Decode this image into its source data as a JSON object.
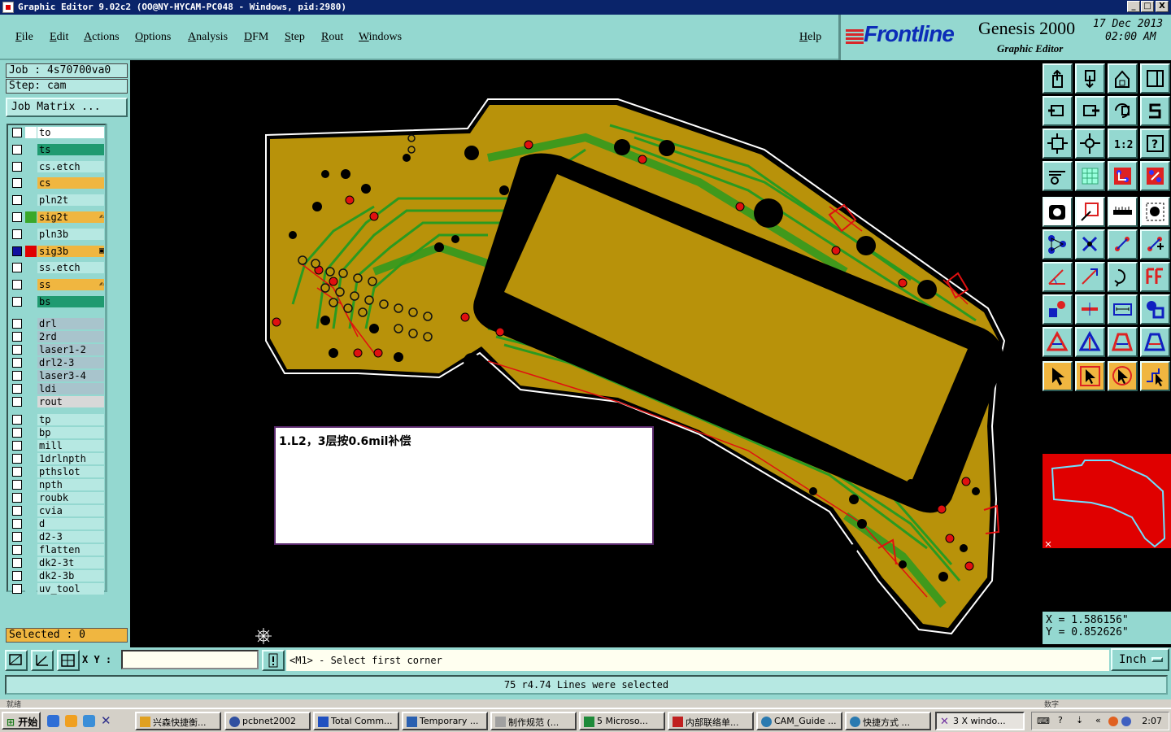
{
  "window": {
    "title": "Graphic Editor 9.02c2 (OO@NY-HYCAM-PC048 - Windows, pid:2980)",
    "controls": [
      "_",
      "□",
      "X"
    ]
  },
  "menu": [
    "File",
    "Edit",
    "Actions",
    "Options",
    "Analysis",
    "DFM",
    "Step",
    "Rout",
    "Windows"
  ],
  "help": "Help",
  "brand": {
    "logo": "Frontline",
    "product": "Genesis 2000",
    "subtitle": "Graphic Editor",
    "date": "17 Dec 2013",
    "time": "02:00 AM"
  },
  "job": {
    "job_line": "Job : 4s70700va0",
    "step_line": "Step: cam",
    "matrix_button": "Job Matrix ..."
  },
  "layers": [
    {
      "name": "to",
      "bg": "#ffffff",
      "swatch": "#ffffff"
    },
    {
      "name": "ts",
      "bg": "#1f9a70",
      "swatch": "#94d8d0"
    },
    {
      "name": "cs.etch",
      "bg": "#b6e8e2",
      "swatch": "#94d8d0"
    },
    {
      "name": "cs",
      "bg": "#f0b640",
      "swatch": "#94d8d0"
    },
    {
      "name": "pln2t",
      "bg": "#b6e8e2",
      "swatch": "#94d8d0"
    },
    {
      "name": "sig2t",
      "bg": "#f0b640",
      "swatch": "#3aa82a",
      "mark": "✍"
    },
    {
      "name": "pln3b",
      "bg": "#b6e8e2",
      "swatch": "#94d8d0"
    },
    {
      "name": "sig3b",
      "bg": "#f0b640",
      "swatch": "#e00000",
      "mark": "▣",
      "checkbox": "#1010a0"
    },
    {
      "name": "ss.etch",
      "bg": "#b6e8e2",
      "swatch": "#94d8d0"
    },
    {
      "name": "ss",
      "bg": "#f0b640",
      "swatch": "#94d8d0",
      "mark": "✍"
    },
    {
      "name": "bs",
      "bg": "#1f9a70",
      "swatch": "#94d8d0"
    },
    {
      "name": "drl",
      "bg": "#a8c4cc",
      "swatch": "#94d8d0"
    },
    {
      "name": "2rd",
      "bg": "#a8c4cc",
      "swatch": "#94d8d0"
    },
    {
      "name": "laser1-2",
      "bg": "#a8c4cc",
      "swatch": "#94d8d0"
    },
    {
      "name": "drl2-3",
      "bg": "#a8c4cc",
      "swatch": "#94d8d0"
    },
    {
      "name": "laser3-4",
      "bg": "#a8c4cc",
      "swatch": "#94d8d0"
    },
    {
      "name": "ldi",
      "bg": "#a8c4cc",
      "swatch": "#94d8d0"
    },
    {
      "name": "rout",
      "bg": "#d8d8d8",
      "swatch": "#94d8d0"
    },
    {
      "name": "tp",
      "bg": "#b6e8e2",
      "swatch": "#94d8d0"
    },
    {
      "name": "bp",
      "bg": "#b6e8e2",
      "swatch": "#94d8d0"
    },
    {
      "name": "mill",
      "bg": "#b6e8e2",
      "swatch": "#94d8d0"
    },
    {
      "name": "1drlnpth",
      "bg": "#b6e8e2",
      "swatch": "#94d8d0"
    },
    {
      "name": "pthslot",
      "bg": "#b6e8e2",
      "swatch": "#94d8d0"
    },
    {
      "name": "npth",
      "bg": "#b6e8e2",
      "swatch": "#94d8d0"
    },
    {
      "name": "roubk",
      "bg": "#b6e8e2",
      "swatch": "#94d8d0"
    },
    {
      "name": "cvia",
      "bg": "#b6e8e2",
      "swatch": "#94d8d0"
    },
    {
      "name": "d",
      "bg": "#b6e8e2",
      "swatch": "#94d8d0"
    },
    {
      "name": "d2-3",
      "bg": "#b6e8e2",
      "swatch": "#94d8d0"
    },
    {
      "name": "flatten",
      "bg": "#b6e8e2",
      "swatch": "#94d8d0"
    },
    {
      "name": "dk2-3t",
      "bg": "#b6e8e2",
      "swatch": "#94d8d0"
    },
    {
      "name": "dk2-3b",
      "bg": "#b6e8e2",
      "swatch": "#94d8d0"
    },
    {
      "name": "uv_tool",
      "bg": "#b6e8e2",
      "swatch": "#94d8d0"
    }
  ],
  "selected_count": "Selected : 0",
  "note_text": "1.L2，3层按0.6mil补偿",
  "coords": {
    "x": "X  =  1.586156\"",
    "y": "Y  =  0.852626\""
  },
  "xy_label": "X Y :",
  "xy_value": "",
  "prompt": "<M1> - Select first corner",
  "unit": "Inch",
  "status_message": "75 r4.74 Lines were selected",
  "strip_left": "就绪",
  "strip_right": "数字",
  "taskbar": {
    "start": "开始",
    "tasks": [
      "兴森快捷衡...",
      "pcbnet2002",
      "Total Comm...",
      "Temporary ...",
      "制作规范 (...",
      "5 Microso...",
      "内部联络单...",
      "CAM_Guide ...",
      "快捷方式 ...",
      "3 X windo..."
    ],
    "clock": "2:07"
  },
  "tools": [
    "open-job-icon",
    "save-icon",
    "home-icon",
    "window-layout-icon",
    "move-left-icon",
    "move-right-icon",
    "undo-icon",
    "step-switch-icon",
    "zoom-fit-icon",
    "zoom-home-icon",
    "scale-1-2-icon",
    "help-query-icon",
    "measure-tool-icon",
    "grid-icon",
    "snap-red-icon",
    "snap-red-alt-icon",
    "layer-display-icon",
    "clip-icon",
    "ruler-icon",
    "pad-icon",
    "connect-nodes-icon",
    "delete-node-icon",
    "move-point-icon",
    "add-point-icon",
    "angle-line-icon",
    "line-draw-icon",
    "arc-icon",
    "text-icon",
    "move-feature-icon",
    "horizontal-line-icon",
    "dimension-icon",
    "rotate-icon",
    "triangle-icon",
    "triangle-alt-icon",
    "shape-a-icon",
    "shape-b-icon",
    "select-arrow-icon",
    "select-box-icon",
    "select-lasso-icon",
    "select-net-icon"
  ]
}
